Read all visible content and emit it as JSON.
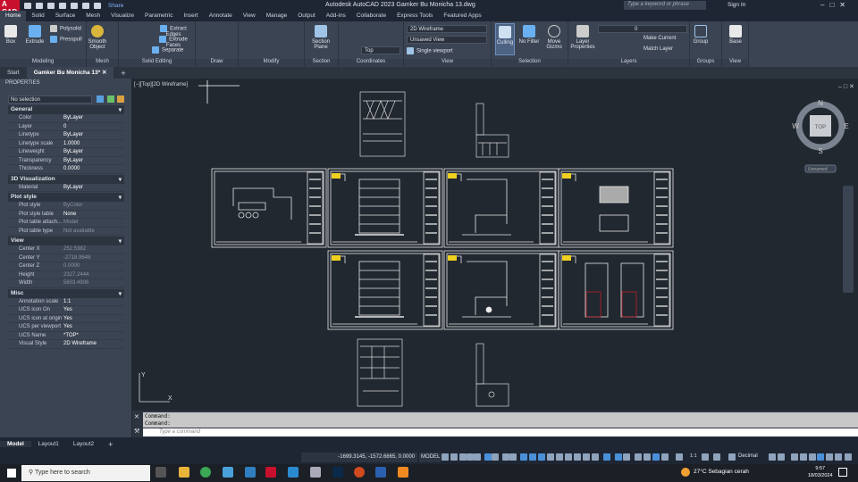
{
  "app": {
    "logo": "A CAD",
    "title": "Autodesk AutoCAD 2023    Gamker Bu Monicha 13.dwg",
    "share": "Share",
    "search_placeholder": "Type a keyword or phrase",
    "sign_in": "Sign In"
  },
  "ribbon_tabs": [
    "Home",
    "Solid",
    "Surface",
    "Mesh",
    "Visualize",
    "Parametric",
    "Insert",
    "Annotate",
    "View",
    "Manage",
    "Output",
    "Add-ins",
    "Collaborate",
    "Express Tools",
    "Featured Apps"
  ],
  "ribbon": {
    "modeling": {
      "label": "Modeling",
      "box": "Box",
      "extrude": "Extrude",
      "polysolid": "Polysolid",
      "presspull": "Presspull"
    },
    "mesh": {
      "label": "Mesh",
      "smooth": "Smooth Object"
    },
    "solid_editing": {
      "label": "Solid Editing",
      "extract": "Extract Edges",
      "extrude_faces": "Extrude Faces",
      "separate": "Separate"
    },
    "draw": {
      "label": "Draw"
    },
    "modify": {
      "label": "Modify"
    },
    "section": {
      "label": "Section",
      "plane": "Section Plane"
    },
    "coordinates": {
      "label": "Coordinates",
      "top": "Top"
    },
    "view": {
      "label": "View",
      "visual_style": "2D Wireframe",
      "named_view": "Unsaved View",
      "viewport": "Single viewport"
    },
    "selection": {
      "label": "Selection",
      "culling": "Culling",
      "no_filter": "No Filter",
      "move_gizmo": "Move Gizmo"
    },
    "layers": {
      "label": "Layers",
      "layer_properties": "Layer Properties",
      "current_layer": "0",
      "make_current": "Make Current",
      "match_layer": "Match Layer"
    },
    "groups": {
      "label": "Groups",
      "group": "Group"
    },
    "view2": {
      "label": "View",
      "base": "Base"
    }
  },
  "doc_tabs": {
    "start": "Start",
    "active": "Gamker Bu Monicha 13*"
  },
  "properties": {
    "title": "PROPERTIES",
    "selection": "No selection",
    "groups": [
      {
        "name": "General",
        "rows": [
          [
            "Color",
            "ByLayer"
          ],
          [
            "Layer",
            "0"
          ],
          [
            "Linetype",
            "ByLayer"
          ],
          [
            "Linetype scale",
            "1.0000"
          ],
          [
            "Lineweight",
            "ByLayer"
          ],
          [
            "Transparency",
            "ByLayer"
          ],
          [
            "Thickness",
            "0.0000"
          ]
        ]
      },
      {
        "name": "3D Visualization",
        "rows": [
          [
            "Material",
            "ByLayer"
          ]
        ]
      },
      {
        "name": "Plot style",
        "rows": [
          [
            "Plot style",
            "ByColor"
          ],
          [
            "Plot style table",
            "None"
          ],
          [
            "Plot table attach...",
            "Model"
          ],
          [
            "Plot table type",
            "Not available"
          ]
        ]
      },
      {
        "name": "View",
        "rows": [
          [
            "Center X",
            "252.5382"
          ],
          [
            "Center Y",
            "-2718.9648"
          ],
          [
            "Center Z",
            "0.0000"
          ],
          [
            "Height",
            "2327.2444"
          ],
          [
            "Width",
            "5603.4906"
          ]
        ]
      },
      {
        "name": "Misc",
        "rows": [
          [
            "Annotation scale",
            "1:1"
          ],
          [
            "UCS icon On",
            "Yes"
          ],
          [
            "UCS icon at origin",
            "Yes"
          ],
          [
            "UCS per viewport",
            "Yes"
          ],
          [
            "UCS Name",
            "*TOP*"
          ],
          [
            "Visual Style",
            "2D Wireframe"
          ]
        ]
      }
    ]
  },
  "viewport": {
    "label": "[−][Top][2D Wireframe]",
    "viewcube": {
      "n": "N",
      "s": "S",
      "e": "E",
      "w": "W",
      "face": "TOP",
      "ucs": "Unnamed"
    },
    "ucs_y": "Y",
    "ucs_x": "X"
  },
  "command": {
    "history": [
      "Command:",
      "Command:"
    ],
    "placeholder": "Type a command"
  },
  "layout_tabs": [
    "Model",
    "Layout1",
    "Layout2"
  ],
  "status": {
    "coords": "-1699.3145, -1572.6865, 0.0000",
    "model": "MODEL",
    "scale": "1:1",
    "units": "Decimal"
  },
  "taskbar": {
    "search": "Type here to search",
    "weather": "27°C  Sebagian cerah",
    "time": "9:57",
    "date": "18/03/2024"
  },
  "colors": {
    "accent": "#c8102e",
    "bg": "#212830",
    "ribbon": "#3b4453"
  }
}
